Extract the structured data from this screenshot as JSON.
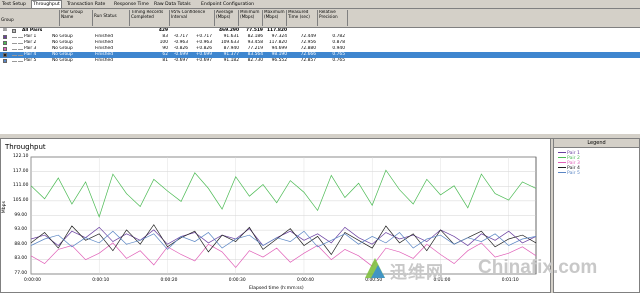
{
  "tabs": [
    {
      "label": "Test Setup"
    },
    {
      "label": "Throughput"
    },
    {
      "label": "Transaction Rate"
    },
    {
      "label": "Response Time"
    },
    {
      "label": "Raw Data Totals"
    },
    {
      "label": "Endpoint Configuration"
    }
  ],
  "table": {
    "headers": {
      "group": "Group",
      "pair_group_name": "Pair Group Name",
      "run_status": "Run Status",
      "timing_records": "Timing Records Completed",
      "confidence": "95% Confidence Interval",
      "average": "Average (Mbps)",
      "minimum": "Minimum (Mbps)",
      "maximum": "Maximum (Mbps)",
      "measured_time": "Measured Time (sec)",
      "relative_precision": "Relative Precision"
    },
    "summary": {
      "label": "All Pairs",
      "timing_records": "429",
      "average": "469.290",
      "minimum": "77.519",
      "maximum": "117.820"
    },
    "rows": [
      {
        "name": "Pair 1",
        "group": "No Group",
        "status": "Finished",
        "records": "83",
        "ci_low": "-0.717",
        "ci_high": "+0.717",
        "avg": "91.631",
        "min": "82.186",
        "max": "97.324",
        "time": "72.449",
        "precision": "0.782",
        "selected": false
      },
      {
        "name": "Pair 2",
        "group": "No Group",
        "status": "Finished",
        "records": "100",
        "ci_low": "-0.963",
        "ci_high": "+0.963",
        "avg": "109.633",
        "min": "93.458",
        "max": "117.820",
        "time": "72.956",
        "precision": "0.878",
        "selected": false
      },
      {
        "name": "Pair 3",
        "group": "No Group",
        "status": "Finished",
        "records": "90",
        "ci_low": "-0.826",
        "ci_high": "+0.826",
        "avg": "87.940",
        "min": "77.219",
        "max": "94.699",
        "time": "72.880",
        "precision": "0.940",
        "selected": false
      },
      {
        "name": "Pair 4",
        "group": "No Group",
        "status": "Finished",
        "records": "62",
        "ci_low": "-0.699",
        "ci_high": "+0.699",
        "avg": "91.377",
        "min": "83.564",
        "max": "98.190",
        "time": "72.666",
        "precision": "0.765",
        "selected": true
      },
      {
        "name": "Pair 5",
        "group": "No Group",
        "status": "Finished",
        "records": "81",
        "ci_low": "-0.697",
        "ci_high": "+0.697",
        "avg": "91.182",
        "min": "82.730",
        "max": "96.552",
        "time": "72.857",
        "precision": "0.765",
        "selected": false
      }
    ]
  },
  "chart_title": "Throughput",
  "legend_title": "Legend",
  "colors": {
    "pair1": "#6a3fa0",
    "pair2": "#4dbb55",
    "pair3": "#e060b8",
    "pair4": "#202020",
    "pair5": "#5a86c4",
    "selection": "#3e86cf"
  },
  "chart_data": {
    "type": "line",
    "title": "Throughput",
    "xlabel": "Elapsed time (h:mm:ss)",
    "ylabel": "Mbps",
    "ylim": [
      77.0,
      122.1
    ],
    "yticks": [
      "122.10",
      "117.00",
      "111.00",
      "105.00",
      "99.00",
      "93.00",
      "88.00",
      "83.00",
      "77.00"
    ],
    "xticks": [
      "0:00:00",
      "0:00:10",
      "0:00:20",
      "0:00:30",
      "0:00:40",
      "0:00:50",
      "0:01:00",
      "0:01:10"
    ],
    "x_range_seconds": [
      0,
      74
    ],
    "series": [
      {
        "name": "Pair 1",
        "values": [
          90.5,
          92.0,
          88.0,
          93.5,
          91.0,
          95.0,
          89.5,
          92.5,
          90.0,
          94.0,
          88.5,
          91.5,
          93.0,
          89.0,
          92.0,
          90.5,
          94.5,
          88.0,
          91.0,
          93.5,
          90.0,
          92.5,
          89.0,
          95.0,
          91.0,
          88.5,
          93.0,
          90.5,
          92.0,
          89.5,
          94.0,
          91.5,
          88.0,
          92.5,
          90.0,
          93.5,
          89.0,
          91.5
        ]
      },
      {
        "name": "Pair 2",
        "values": [
          111.0,
          106.0,
          114.0,
          104.0,
          112.5,
          99.0,
          115.5,
          108.0,
          103.0,
          113.5,
          109.0,
          105.0,
          116.0,
          110.0,
          102.0,
          114.5,
          107.0,
          111.5,
          104.5,
          113.0,
          108.5,
          101.5,
          115.0,
          106.5,
          112.0,
          103.5,
          117.0,
          109.5,
          104.0,
          113.5,
          107.5,
          111.0,
          102.5,
          115.5,
          108.0,
          105.5,
          112.5,
          110.0
        ]
      },
      {
        "name": "Pair 3",
        "values": [
          84.0,
          81.0,
          86.5,
          88.0,
          82.5,
          85.0,
          89.0,
          83.0,
          86.0,
          80.5,
          87.5,
          84.5,
          82.0,
          88.5,
          85.5,
          79.5,
          86.0,
          83.5,
          87.0,
          81.5,
          85.0,
          88.0,
          82.5,
          86.5,
          84.0,
          80.0,
          87.0,
          85.5,
          83.0,
          88.5,
          84.5,
          81.0,
          86.0,
          89.0,
          83.5,
          85.0,
          87.5,
          84.0
        ]
      },
      {
        "name": "Pair 4",
        "values": [
          89.0,
          93.0,
          87.0,
          95.5,
          90.0,
          92.5,
          86.0,
          94.0,
          88.5,
          96.0,
          87.5,
          91.0,
          93.5,
          85.5,
          92.0,
          89.5,
          95.0,
          86.5,
          90.5,
          94.5,
          88.0,
          91.5,
          84.5,
          93.0,
          90.0,
          87.0,
          95.5,
          89.0,
          92.5,
          86.0,
          94.0,
          88.5,
          91.0,
          93.5,
          87.5,
          90.5,
          92.0,
          89.0
        ]
      },
      {
        "name": "Pair 5",
        "values": [
          88.0,
          90.5,
          92.0,
          87.5,
          91.0,
          89.0,
          93.5,
          88.5,
          90.0,
          92.5,
          86.5,
          91.5,
          89.5,
          93.0,
          87.0,
          90.5,
          92.0,
          88.0,
          91.0,
          89.5,
          93.5,
          87.5,
          90.0,
          92.5,
          88.5,
          91.5,
          89.0,
          93.0,
          87.0,
          90.5,
          92.0,
          88.5,
          91.0,
          89.5,
          92.5,
          88.0,
          90.5,
          91.5
        ]
      }
    ],
    "grid": true,
    "legend_placement": "right"
  },
  "watermark": {
    "cn_text": "迅维网",
    "en_text": "Chinafix.com"
  }
}
